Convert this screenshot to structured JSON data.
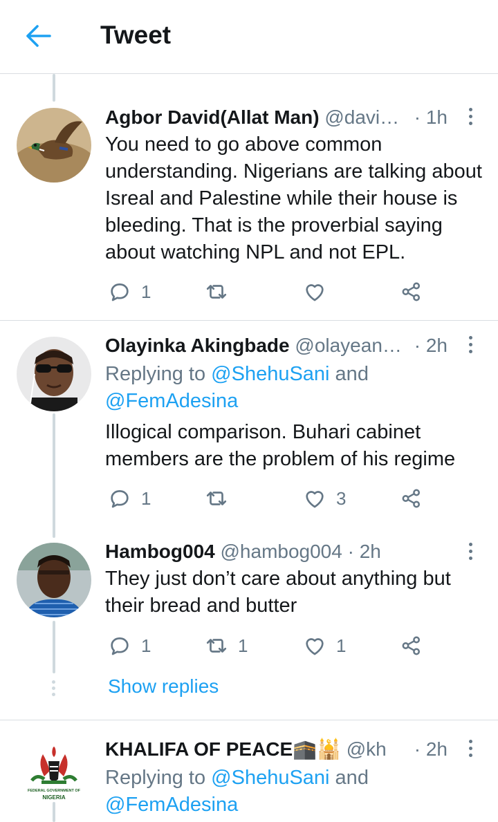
{
  "header": {
    "title": "Tweet"
  },
  "tweets": [
    {
      "name": "Agbor David(Allat Man)",
      "handle": "@davi…",
      "time": "· 1h",
      "reply_prefix": "",
      "reply_to_1": "",
      "reply_and": "",
      "reply_to_2": "",
      "text": "You need to go above common understanding. Nigerians are talking about Isreal and Palestine while their house is bleeding. That is the proverbial saying about watching NPL and not EPL.",
      "replies": "1",
      "retweets": "",
      "likes": ""
    },
    {
      "name": "Olayinka Akingbade",
      "handle": "@olayean…",
      "time": "· 2h",
      "reply_prefix": "Replying to ",
      "reply_to_1": "@ShehuSani",
      "reply_and": " and",
      "reply_to_2": "@FemAdesina",
      "text": "Illogical comparison. Buhari cabinet members are the problem of his regime",
      "replies": "1",
      "retweets": "",
      "likes": "3"
    },
    {
      "name": "Hambog004",
      "handle": "@hambog004 · 2h",
      "time": "",
      "reply_prefix": "",
      "reply_to_1": "",
      "reply_and": "",
      "reply_to_2": "",
      "text": "They just don’t care about anything but their bread and butter",
      "replies": "1",
      "retweets": "1",
      "likes": "1"
    },
    {
      "name": "KHALIFA OF PEACE🕋🕌",
      "handle": "@kha…",
      "time": "· 2h",
      "reply_prefix": "Replying to ",
      "reply_to_1": "@ShehuSani",
      "reply_and": " and",
      "reply_to_2": "@FemAdesina",
      "text": "",
      "replies": "",
      "retweets": "",
      "likes": "",
      "avatar_text_1": "FEDERAL GOVERNMENT OF",
      "avatar_text_2": "NIGERIA"
    }
  ],
  "show_replies": "Show replies",
  "colors": {
    "accent": "#1da1f2",
    "secondary": "#657786",
    "divider": "#d9dde1",
    "thread": "#cfd9de"
  }
}
